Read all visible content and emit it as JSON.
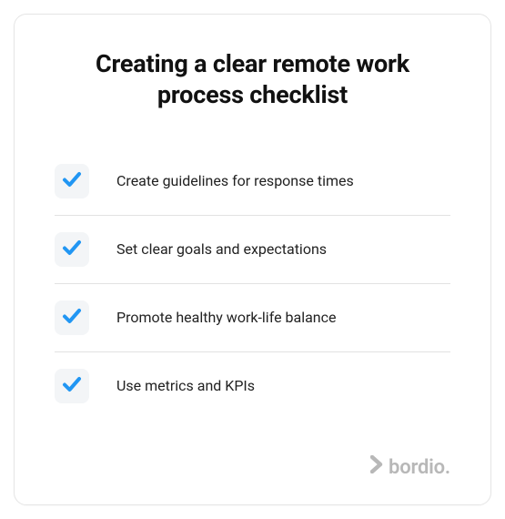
{
  "title": "Creating a clear remote work process checklist",
  "items": [
    {
      "label": "Create guidelines for response times",
      "checked": true
    },
    {
      "label": "Set clear goals and expectations",
      "checked": true
    },
    {
      "label": "Promote healthy work-life balance",
      "checked": true
    },
    {
      "label": "Use metrics and KPIs",
      "checked": true
    }
  ],
  "brand": "bordio.",
  "colors": {
    "accent": "#2196f3",
    "muted": "#b8b8b8",
    "checkbox_bg": "#f3f5f7",
    "divider": "#e2e2e2"
  }
}
